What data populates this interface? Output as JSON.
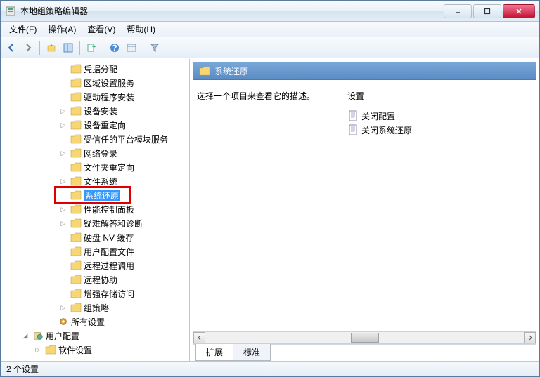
{
  "title": "本地组策略编辑器",
  "menubar": {
    "file": "文件(F)",
    "action": "操作(A)",
    "view": "查看(V)",
    "help": "帮助(H)"
  },
  "tree": {
    "items": [
      {
        "label": "凭据分配",
        "indent": 4,
        "expander": ""
      },
      {
        "label": "区域设置服务",
        "indent": 4,
        "expander": ""
      },
      {
        "label": "驱动程序安装",
        "indent": 4,
        "expander": ""
      },
      {
        "label": "设备安装",
        "indent": 4,
        "expander": "▷"
      },
      {
        "label": "设备重定向",
        "indent": 4,
        "expander": "▷"
      },
      {
        "label": "受信任的平台模块服务",
        "indent": 4,
        "expander": ""
      },
      {
        "label": "网络登录",
        "indent": 4,
        "expander": "▷"
      },
      {
        "label": "文件夹重定向",
        "indent": 4,
        "expander": ""
      },
      {
        "label": "文件系统",
        "indent": 4,
        "expander": "▷"
      },
      {
        "label": "系统还原",
        "indent": 4,
        "expander": "",
        "selected": true,
        "highlight": true
      },
      {
        "label": "性能控制面板",
        "indent": 4,
        "expander": "▷"
      },
      {
        "label": "疑难解答和诊断",
        "indent": 4,
        "expander": "▷"
      },
      {
        "label": "硬盘 NV 缓存",
        "indent": 4,
        "expander": ""
      },
      {
        "label": "用户配置文件",
        "indent": 4,
        "expander": ""
      },
      {
        "label": "远程过程调用",
        "indent": 4,
        "expander": ""
      },
      {
        "label": "远程协助",
        "indent": 4,
        "expander": ""
      },
      {
        "label": "增强存储访问",
        "indent": 4,
        "expander": ""
      },
      {
        "label": "组策略",
        "indent": 4,
        "expander": "▷"
      },
      {
        "label": "所有设置",
        "indent": 3,
        "expander": "",
        "icon": "gear"
      },
      {
        "label": "用户配置",
        "indent": 1,
        "expander": "◢",
        "icon": "user"
      },
      {
        "label": "软件设置",
        "indent": 2,
        "expander": "▷"
      }
    ]
  },
  "right": {
    "header": "系统还原",
    "desc": "选择一个项目来查看它的描述。",
    "settings_header": "设置",
    "settings": [
      {
        "label": "关闭配置"
      },
      {
        "label": "关闭系统还原"
      }
    ],
    "tabs": {
      "extended": "扩展",
      "standard": "标准"
    }
  },
  "status": "2 个设置"
}
